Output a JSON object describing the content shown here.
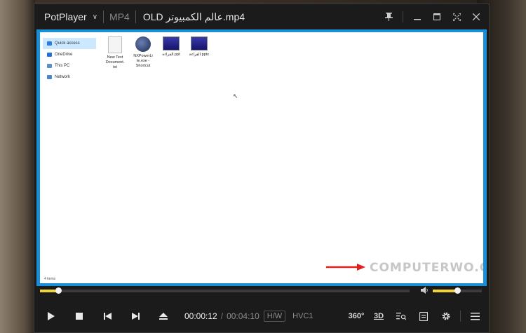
{
  "window": {
    "app_name": "PotPlayer",
    "format": "MP4",
    "file_name": "OLD عالم الكمبيوتر.mp4"
  },
  "icons": {
    "menu_chevron": "chevron-down-icon",
    "pin": "pin-icon",
    "minimize": "minimize-icon",
    "maximize": "maximize-icon",
    "fullscreen": "fullscreen-icon",
    "close": "close-icon"
  },
  "video_content": {
    "sidebar": [
      {
        "label": "Quick access",
        "selected": true,
        "color": "#2f7de1"
      },
      {
        "label": "OneDrive",
        "selected": false,
        "color": "#1e73d6"
      },
      {
        "label": "This PC",
        "selected": false,
        "color": "#5a8fc9"
      },
      {
        "label": "Network",
        "selected": false,
        "color": "#4a86c8"
      }
    ],
    "files": [
      {
        "label_line1": "New Text",
        "label_line2": "Document.",
        "label_line3": "txt"
      },
      {
        "label_line1": "NXPowerLi",
        "label_line2": "te.exe -",
        "label_line3": "Shortcut"
      },
      {
        "label_line1": "القراءة.ppt",
        "label_line2": "",
        "label_line3": ""
      },
      {
        "label_line1": "القراءة.pptx",
        "label_line2": "",
        "label_line3": ""
      }
    ],
    "status": "4 items",
    "watermark": "COMPUTERWO.COM"
  },
  "playback": {
    "seek_progress": 0.05,
    "volume_level": 0.5,
    "current_time": "00:00:12",
    "separator": "/",
    "duration": "00:04:10",
    "decoder_badge": "H/W",
    "codec_badge": "HVC1",
    "btn_360": "360°",
    "btn_3d": "3D"
  },
  "colors": {
    "accent": "#f2d335",
    "panel": "#1b1b1b",
    "video_border": "#1a8fd6",
    "arrow": "#e02020"
  }
}
